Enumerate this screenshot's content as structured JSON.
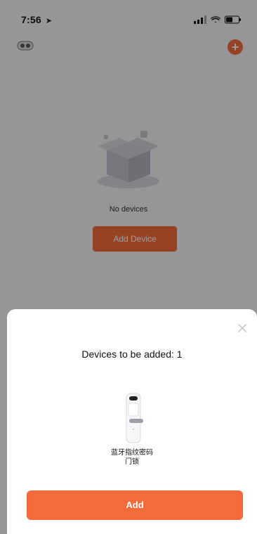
{
  "status_bar": {
    "time": "7:56",
    "icons": [
      "location-arrow-icon",
      "cellular-signal-icon",
      "wifi-icon",
      "battery-icon"
    ]
  },
  "header": {
    "left_icon": "profile-pill-icon",
    "right_icon": "plus-icon"
  },
  "background_page": {
    "empty_text": "No devices",
    "add_device_label": "Add Device"
  },
  "sheet": {
    "title": "Devices to be added: 1",
    "close_icon": "close-x-icon",
    "device": {
      "name_line1": "蓝牙指纹密码",
      "name_line2": "门锁",
      "image_icon": "door-lock-icon"
    },
    "add_label": "Add"
  },
  "colors": {
    "accent": "#f26b3a",
    "background": "#f2f2f4",
    "overlay": "rgba(0,0,0,0.38)",
    "sheet": "#ffffff"
  }
}
